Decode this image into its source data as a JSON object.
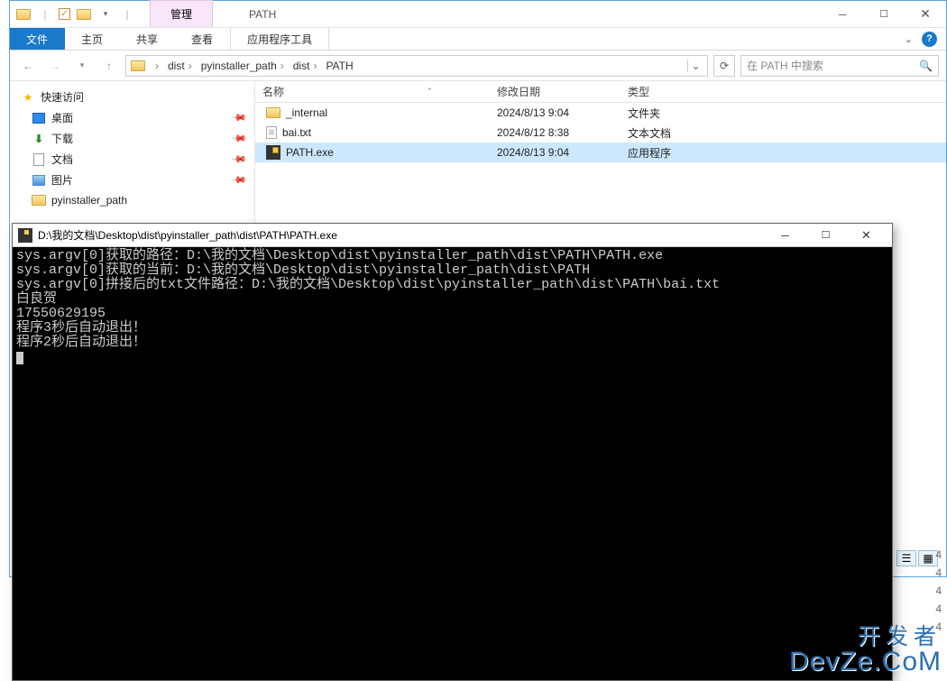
{
  "explorer": {
    "window_title": "PATH",
    "context_tab": "管理",
    "context_group": "应用程序工具",
    "ribbon": [
      "文件",
      "主页",
      "共享",
      "查看"
    ],
    "breadcrumb": [
      "dist",
      "pyinstaller_path",
      "dist",
      "PATH"
    ],
    "search_placeholder": "在 PATH 中搜索",
    "columns": {
      "name": "名称",
      "date": "修改日期",
      "type": "类型"
    },
    "sidebar": {
      "quick_access": "快速访问",
      "items": [
        {
          "label": "桌面",
          "kind": "desktop",
          "pinned": true
        },
        {
          "label": "下载",
          "kind": "downloads",
          "pinned": true
        },
        {
          "label": "文档",
          "kind": "documents",
          "pinned": true
        },
        {
          "label": "图片",
          "kind": "pictures",
          "pinned": true
        },
        {
          "label": "pyinstaller_path",
          "kind": "folder",
          "pinned": false
        }
      ]
    },
    "files": [
      {
        "name": "_internal",
        "date": "2024/8/13 9:04",
        "type": "文件夹",
        "icon": "folder"
      },
      {
        "name": "bai.txt",
        "date": "2024/8/12 8:38",
        "type": "文本文档",
        "icon": "txt"
      },
      {
        "name": "PATH.exe",
        "date": "2024/8/13 9:04",
        "type": "应用程序",
        "icon": "exe",
        "selected": true
      }
    ]
  },
  "console": {
    "title": "D:\\我的文档\\Desktop\\dist\\pyinstaller_path\\dist\\PATH\\PATH.exe",
    "lines": [
      "sys.argv[0]获取的路径：D:\\我的文档\\Desktop\\dist\\pyinstaller_path\\dist\\PATH\\PATH.exe",
      "sys.argv[0]获取的当前：D:\\我的文档\\Desktop\\dist\\pyinstaller_path\\dist\\PATH",
      "sys.argv[0]拼接后的txt文件路径：D:\\我的文档\\Desktop\\dist\\pyinstaller_path\\dist\\PATH\\bai.txt",
      "白良贺",
      "17550629195",
      "程序3秒后自动退出！",
      "程序2秒后自动退出！"
    ]
  },
  "peek_numbers": [
    "4",
    "4",
    "4",
    "4",
    "4"
  ],
  "watermark": {
    "zh": "开发者",
    "en": "DevZe.CoM"
  }
}
